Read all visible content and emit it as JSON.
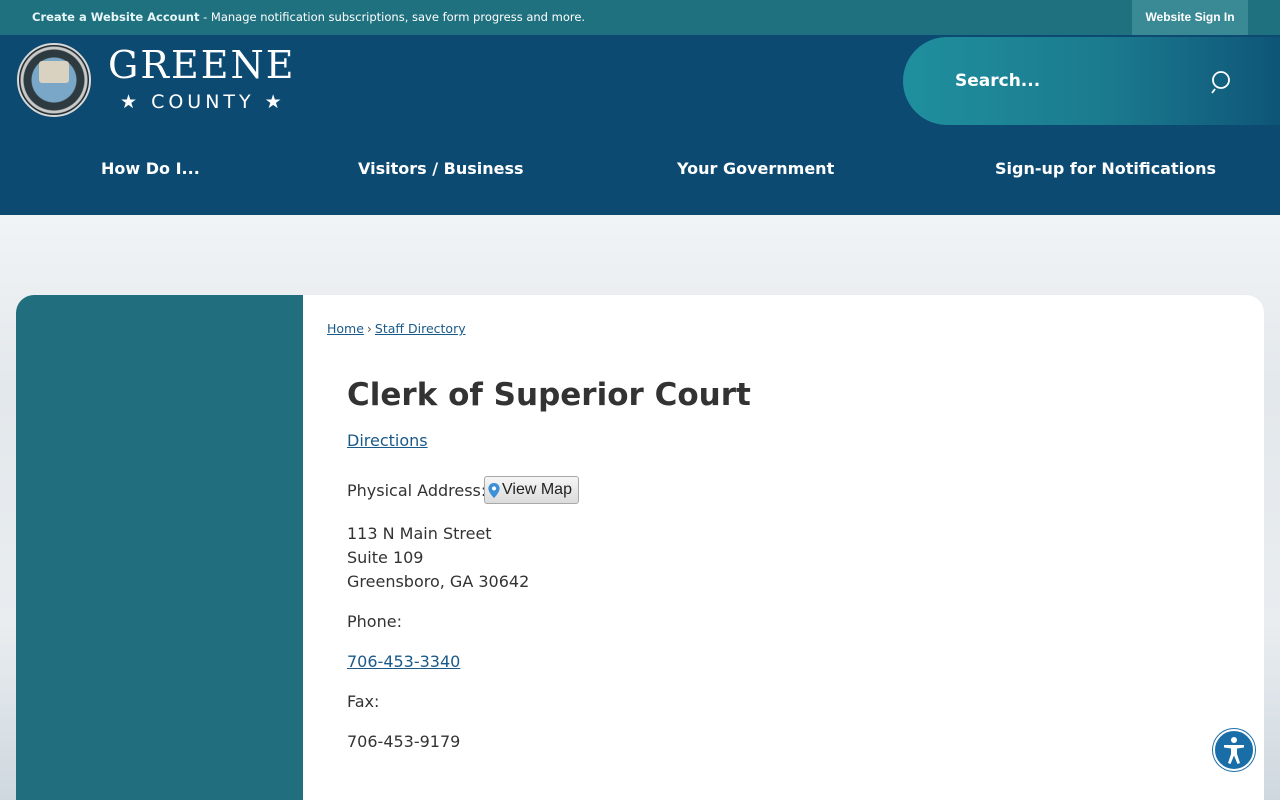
{
  "topbar": {
    "account_link": "Create a Website Account",
    "message": " - Manage notification subscriptions, save form progress and more.",
    "signin": "Website Sign In"
  },
  "logo": {
    "line1": "GREENE",
    "line2": "★ COUNTY ★"
  },
  "search": {
    "placeholder": "Search..."
  },
  "nav": [
    "How Do I...",
    "Visitors / Business",
    "Your Government",
    "Sign-up for Notifications"
  ],
  "breadcrumb": {
    "home": "Home",
    "separator": "›",
    "current": "Staff Directory"
  },
  "page": {
    "title": "Clerk of Superior Court",
    "directions": "Directions",
    "physical_address_label": "Physical Address:",
    "view_map": "View Map",
    "address": [
      "113 N Main Street",
      "Suite 109",
      "Greensboro, GA 30642"
    ],
    "phone_label": "Phone:",
    "phone": "706-453-3340",
    "fax_label": "Fax:",
    "fax": "706-453-9179"
  },
  "icons": {
    "search": "search-icon",
    "map_pin": "map-pin-icon",
    "accessibility": "accessibility-icon"
  },
  "colors": {
    "topbar": "#20717f",
    "header": "#0c4a72",
    "sidebar": "#206e7e",
    "link": "#1a5a8a"
  }
}
